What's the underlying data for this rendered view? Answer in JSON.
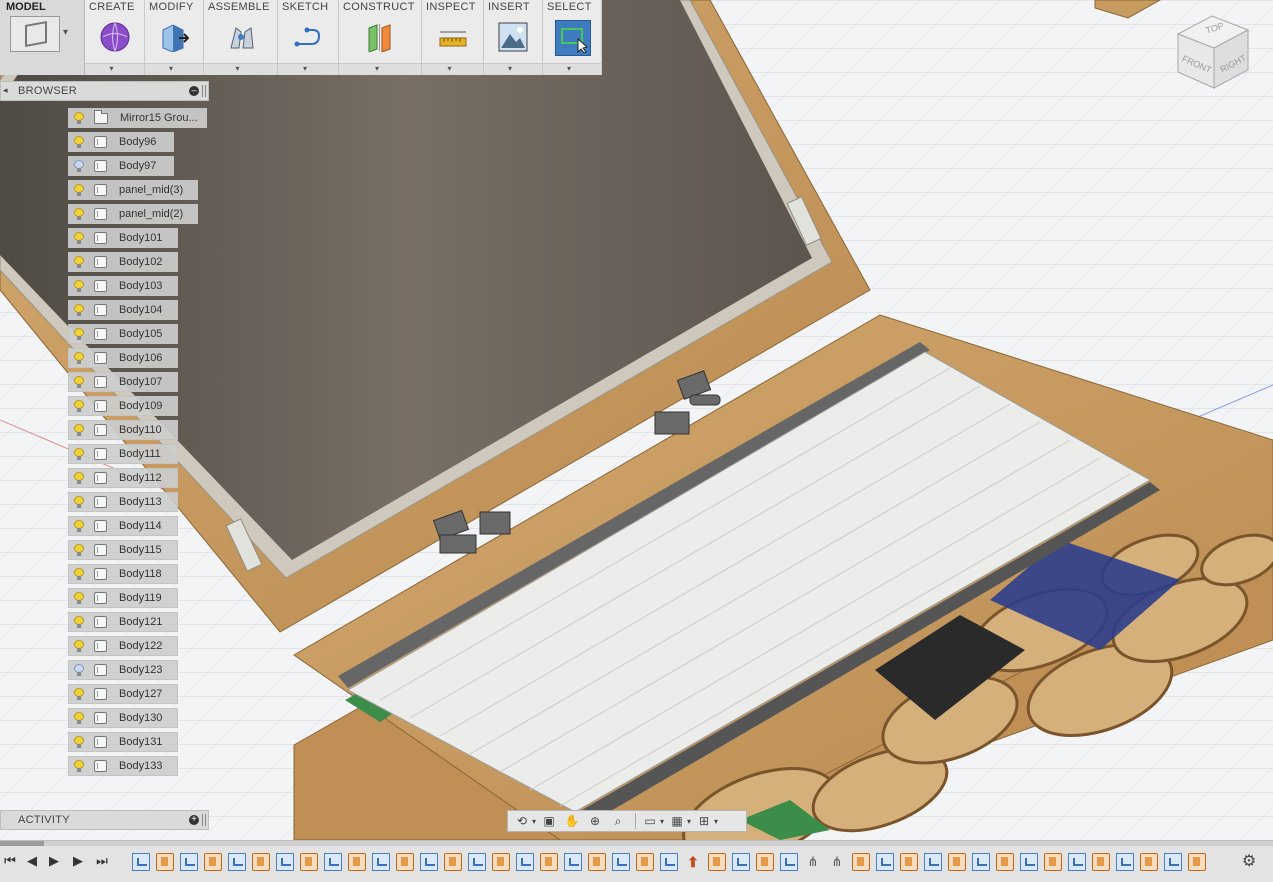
{
  "workspace": {
    "label": "MODEL"
  },
  "toolbar": {
    "groups": [
      {
        "label": "CREATE",
        "icon": "create-sphere-icon"
      },
      {
        "label": "MODIFY",
        "icon": "modify-press-pull-icon"
      },
      {
        "label": "ASSEMBLE",
        "icon": "assemble-joint-icon"
      },
      {
        "label": "SKETCH",
        "icon": "sketch-line-icon"
      },
      {
        "label": "CONSTRUCT",
        "icon": "construct-plane-icon"
      },
      {
        "label": "INSPECT",
        "icon": "inspect-measure-icon"
      },
      {
        "label": "INSERT",
        "icon": "insert-image-icon"
      },
      {
        "label": "SELECT",
        "icon": "select-window-icon",
        "active": true
      }
    ]
  },
  "browser": {
    "title": "BROWSER",
    "items": [
      {
        "label": "Mirror15 Grou...",
        "type": "folder",
        "visible": true
      },
      {
        "label": "Body96",
        "type": "body",
        "visible": true
      },
      {
        "label": "Body97",
        "type": "body",
        "visible": false
      },
      {
        "label": "panel_mid(3)",
        "type": "body",
        "visible": true
      },
      {
        "label": "panel_mid(2)",
        "type": "body",
        "visible": true
      },
      {
        "label": "Body101",
        "type": "body",
        "visible": true
      },
      {
        "label": "Body102",
        "type": "body",
        "visible": true
      },
      {
        "label": "Body103",
        "type": "body",
        "visible": true
      },
      {
        "label": "Body104",
        "type": "body",
        "visible": true
      },
      {
        "label": "Body105",
        "type": "body",
        "visible": true
      },
      {
        "label": "Body106",
        "type": "body",
        "visible": true
      },
      {
        "label": "Body107",
        "type": "body",
        "visible": true
      },
      {
        "label": "Body109",
        "type": "body",
        "visible": true
      },
      {
        "label": "Body110",
        "type": "body",
        "visible": true
      },
      {
        "label": "Body111",
        "type": "body",
        "visible": true
      },
      {
        "label": "Body112",
        "type": "body",
        "visible": true
      },
      {
        "label": "Body113",
        "type": "body",
        "visible": true
      },
      {
        "label": "Body114",
        "type": "body",
        "visible": true
      },
      {
        "label": "Body115",
        "type": "body",
        "visible": true
      },
      {
        "label": "Body118",
        "type": "body",
        "visible": true
      },
      {
        "label": "Body119",
        "type": "body",
        "visible": true
      },
      {
        "label": "Body121",
        "type": "body",
        "visible": true
      },
      {
        "label": "Body122",
        "type": "body",
        "visible": true
      },
      {
        "label": "Body123",
        "type": "body",
        "visible": false
      },
      {
        "label": "Body127",
        "type": "body",
        "visible": true
      },
      {
        "label": "Body130",
        "type": "body",
        "visible": true
      },
      {
        "label": "Body131",
        "type": "body",
        "visible": true
      },
      {
        "label": "Body133",
        "type": "body",
        "visible": true
      }
    ]
  },
  "activity": {
    "title": "ACTIVITY"
  },
  "viewcube": {
    "top": "TOP",
    "front": "FRONT",
    "right": "RIGHT"
  },
  "colors": {
    "wood": "#c79a5e",
    "wood_dark": "#9b6f3a",
    "screen": "#5f5850",
    "keyboard": "#ecedeb",
    "accent": "#3e7bbf"
  },
  "timeline": {
    "features": [
      "sketch",
      "extrude",
      "sketch",
      "extrude",
      "sketch",
      "extrude",
      "sketch",
      "extrude",
      "sketch",
      "extrude",
      "sketch",
      "extrude",
      "sketch",
      "extrude",
      "sketch",
      "extrude",
      "sketch",
      "extrude",
      "sketch",
      "extrude",
      "sketch",
      "extrude",
      "sketch",
      "marker",
      "extrude",
      "sketch",
      "extrude",
      "sketch",
      "joint",
      "joint",
      "extrude",
      "sketch",
      "extrude",
      "sketch",
      "extrude",
      "sketch",
      "extrude",
      "sketch",
      "extrude",
      "sketch",
      "extrude",
      "sketch",
      "extrude",
      "sketch",
      "extrude"
    ]
  }
}
